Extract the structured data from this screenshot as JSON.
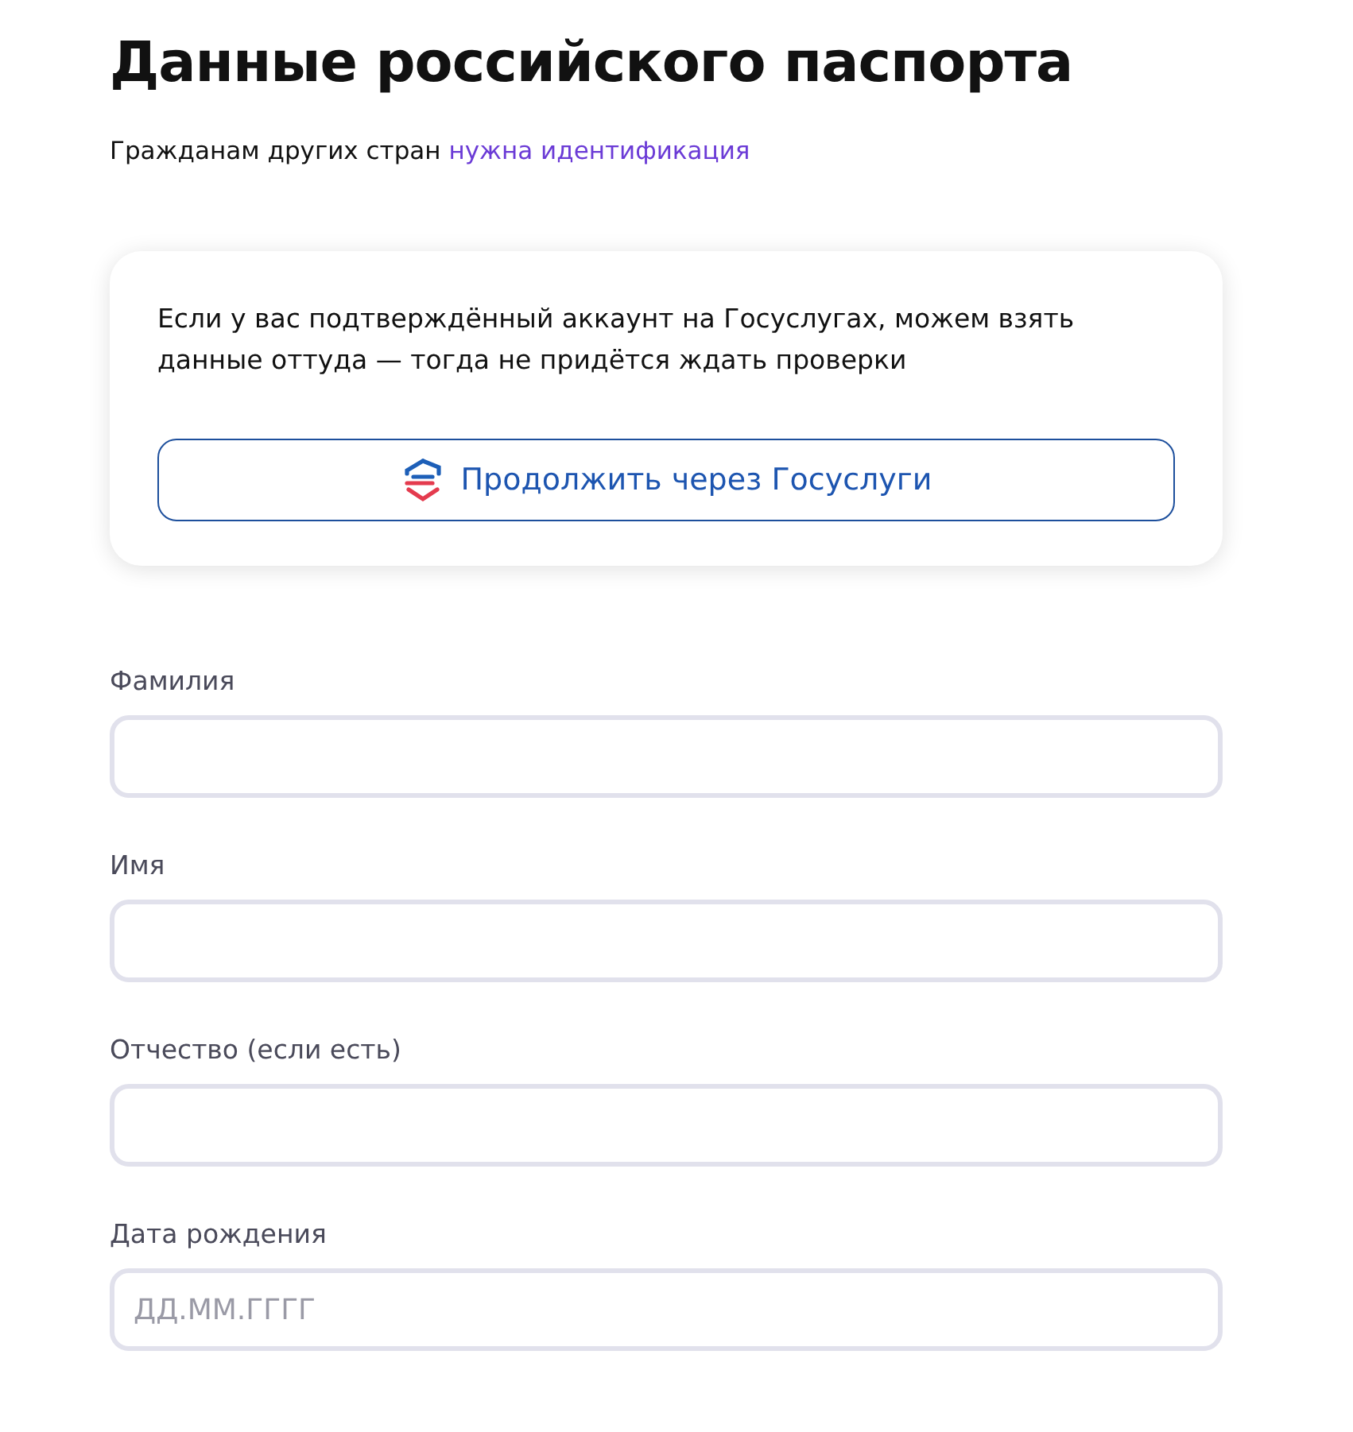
{
  "title": "Данные российского паспорта",
  "subtitle": {
    "text": "Гражданам других стран",
    "link": "нужна идентификация"
  },
  "gosuslugi_card": {
    "text": "Если у вас подтверждённый аккаунт на Госуслугах, можем взять данные оттуда — тогда не придётся ждать проверки",
    "button": "Продолжить через Госуслуги"
  },
  "fields": [
    {
      "label": "Фамилия"
    },
    {
      "label": "Имя"
    },
    {
      "label": "Отчество (если есть)"
    },
    {
      "label": "Дата рождения",
      "placeholder": "ДД.ММ.ГГГГ"
    }
  ]
}
